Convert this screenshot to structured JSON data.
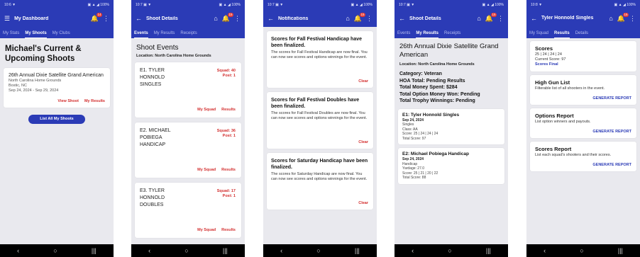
{
  "colors": {
    "primary": "#2b3bb6",
    "accent_red": "#d32f2f",
    "badge": "#e53935",
    "background": "#e9e9ee"
  },
  "nav_glyphs": {
    "back": "‹",
    "home": "○",
    "recents": "|||"
  },
  "screen1": {
    "status_left": "10:6 ▼",
    "status_right": "▣ ▲ ◢ 100%",
    "title": "My Dashboard",
    "badge": "14",
    "tabs": [
      "My Stats",
      "My Shoots",
      "My Clubs"
    ],
    "heading": "Michael's Current & Upcoming Shoots",
    "event": {
      "name": "26th Annual Dixie Satellite Grand American",
      "location": "North Carolina Home Grounds",
      "city": "Bostic, NC",
      "dates": "Sep 24, 2024 - Sep 29, 2024",
      "view_shoot": "View Shoot",
      "my_results": "My Results"
    },
    "list_all": "List All My Shoots"
  },
  "screen2": {
    "status_left": "10:7 ▣ ▼",
    "status_right": "▣ ▲ ◢ 100%",
    "title": "Shoot Details",
    "badge": "15",
    "tabs": [
      "Events",
      "My Results",
      "Receipts"
    ],
    "heading": "Shoot Events",
    "location": "Location: North Carolina Home Grounds",
    "events": [
      {
        "name": "E1. TYLER HONNOLD SINGLES",
        "squad": "Squad: 40",
        "post": "Post: 1",
        "my_squad": "My Squad",
        "results": "Results"
      },
      {
        "name": "E2. MICHAEL POBIEGA HANDICAP",
        "squad": "Squad: 36",
        "post": "Post: 1",
        "my_squad": "My Squad",
        "results": "Results"
      },
      {
        "name": "E3. TYLER HONNOLD DOUBLES",
        "squad": "Squad: 17",
        "post": "Post: 1",
        "my_squad": "My Squad",
        "results": "Results"
      }
    ]
  },
  "screen3": {
    "status_left": "10:7 ▣ ▼",
    "status_right": "▣ ▲ ◢ 100%",
    "title": "Notifications",
    "badge": "15",
    "notifications": [
      {
        "title": "Scores for Fall Festival Handicap have been finalized.",
        "body": "The scores for Fall Festival Handicap are now final. You can now see scores and options winnings for the event.",
        "clear": "Clear"
      },
      {
        "title": "Scores for Fall Festival Doubles have been finalized.",
        "body": "The scores for Fall Festival Doubles are now final. You can now see scores and options winnings for the event.",
        "clear": "Clear"
      },
      {
        "title": "Scores for Saturday Handicap have been finalized.",
        "body": "The scores for Saturday Handicap are now final. You can now see scores and options winnings for the event.",
        "clear": "Clear"
      }
    ]
  },
  "screen4": {
    "status_left": "10:7 ▣ ▼",
    "status_right": "▣ ▲ ◢ 100%",
    "title": "Shoot Details",
    "badge": "15",
    "tabs": [
      "Events",
      "My Results",
      "Receipts"
    ],
    "heading": "26th Annual Dixie Satellite Grand American",
    "location": "Location: North Carolina Home Grounds",
    "summary": {
      "category": "Category: Veteran",
      "hoa": "HOA Total: Pending Results",
      "spent": "Total Money Spent: $284",
      "option_won": "Total Option Money Won: Pending",
      "trophy": "Total Trophy Winnings: Pending"
    },
    "results": [
      {
        "title": "E1: Tyler Honnold Singles",
        "date": "Sep 24, 2024",
        "type": "Singles",
        "detail": "Class: AA",
        "score": "Score: 25 | 24 | 24 | 24",
        "total": "Total Score: 97"
      },
      {
        "title": "E2: Michael Pobiega Handicap",
        "date": "Sep 24, 2024",
        "type": "Handicap",
        "detail": "Yardage: 27.0",
        "score": "Score: 25 | 21 | 20 | 22",
        "total": "Total Score: 88"
      }
    ]
  },
  "screen5": {
    "status_left": "10:8 ▼",
    "status_right": "▣ ▲ ◢ 100%",
    "title": "Tyler Honnold Singles",
    "badge": "15",
    "tabs": [
      "My Squad",
      "Results",
      "Details"
    ],
    "scores": {
      "title": "Scores",
      "line": "25 | 24 | 24 | 24",
      "current": "Current Score: 97",
      "final": "Scores Final"
    },
    "sections": [
      {
        "title": "High Gun List",
        "desc": "Filterable list of all shooters in the event.",
        "button": "GENERATE REPORT"
      },
      {
        "title": "Options Report",
        "desc": "List option winners and payouts.",
        "button": "GENERATE REPORT"
      },
      {
        "title": "Scores Report",
        "desc": "List each squad's shooters and their scores.",
        "button": "GENERATE REPORT"
      }
    ]
  }
}
